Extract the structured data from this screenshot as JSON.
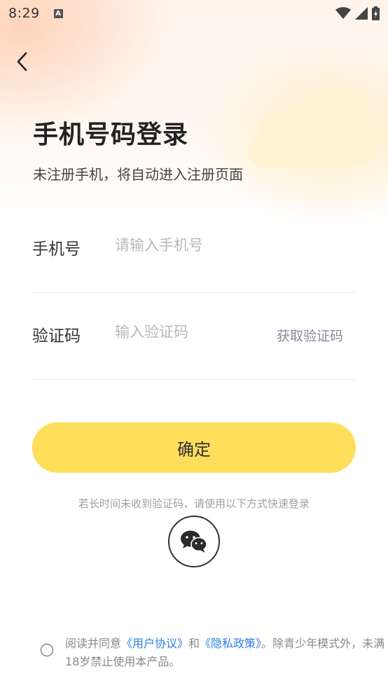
{
  "status_bar": {
    "time": "8:29",
    "notification_icon": "A"
  },
  "header": {
    "back_icon": "chevron-left-icon"
  },
  "title": "手机号码登录",
  "subtitle": "未注册手机，将自动进入注册页面",
  "phone_field": {
    "label": "手机号",
    "placeholder": "请输入手机号",
    "value": ""
  },
  "code_field": {
    "label": "验证码",
    "placeholder": "输入验证码",
    "value": "",
    "get_code_label": "获取验证码"
  },
  "confirm_label": "确定",
  "alt_login": {
    "hint": "若长时间未收到验证码，请使用以下方式快速登录",
    "icon": "wechat-icon"
  },
  "agreement": {
    "prefix": "阅读并同意",
    "user_agreement": "《用户协议》",
    "and": "和",
    "privacy_policy": "《隐私政策》",
    "suffix": "。除青少年模式外，未满18岁禁止使用本产品。"
  },
  "colors": {
    "accent_button": "#ffde5b",
    "link": "#2d7ee6",
    "placeholder": "#b9b9b9"
  }
}
